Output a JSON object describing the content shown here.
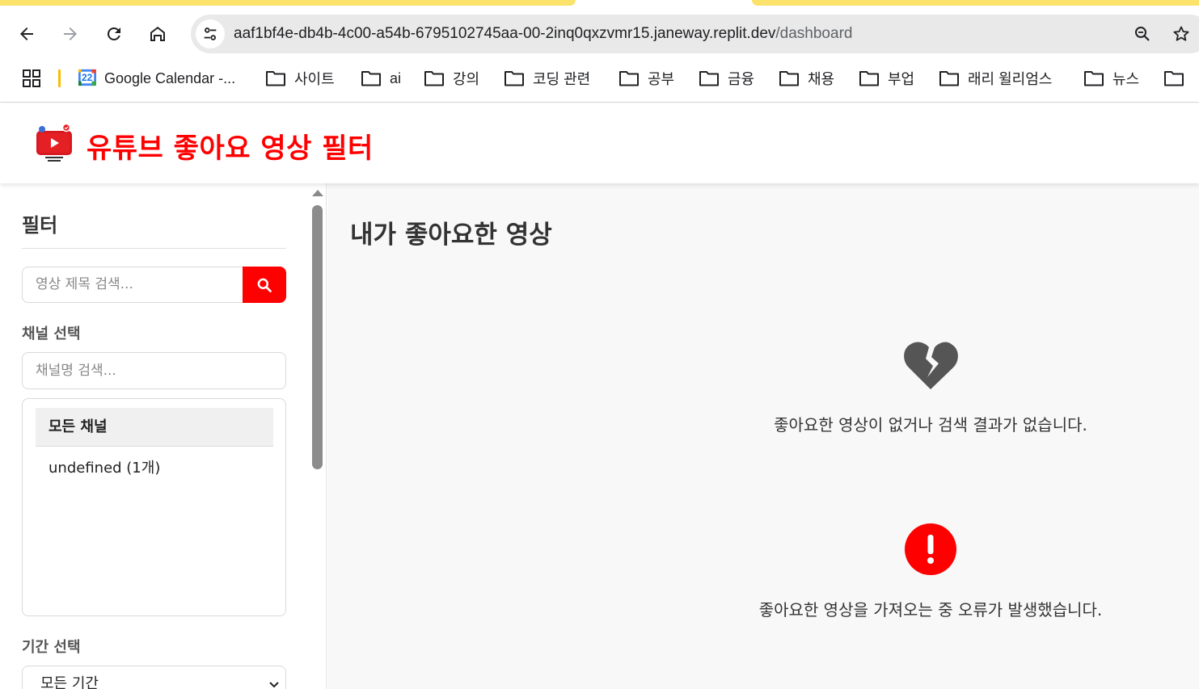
{
  "browser": {
    "url_host": "aaf1bf4e-db4b-4c00-a54b-6795102745aa-00-2inq0qxzvmr15.janeway.replit.dev",
    "url_path": "/dashboard",
    "calendar_day": "22",
    "bookmarks": [
      "Google Calendar -...",
      "사이트",
      "ai",
      "강의",
      "코딩 관련",
      "공부",
      "금융",
      "채용",
      "부업",
      "래리 윌리엄스",
      "뉴스"
    ]
  },
  "app": {
    "title": "유튜브 좋아요 영상 필터"
  },
  "sidebar": {
    "title": "필터",
    "search_placeholder": "영상 제목 검색...",
    "channel_label": "채널 선택",
    "channel_search_placeholder": "채널명 검색...",
    "channels": [
      "모든 채널",
      "undefined (1개)"
    ],
    "period_label": "기간 선택",
    "period_value": "모든 기간"
  },
  "main": {
    "title": "내가 좋아요한 영상",
    "empty_message": "좋아요한 영상이 없거나 검색 결과가 없습니다.",
    "error_message": "좋아요한 영상을 가져오는 중 오류가 발생했습니다."
  },
  "colors": {
    "accent": "#ff0000",
    "tab_active": "#fbe36b"
  }
}
